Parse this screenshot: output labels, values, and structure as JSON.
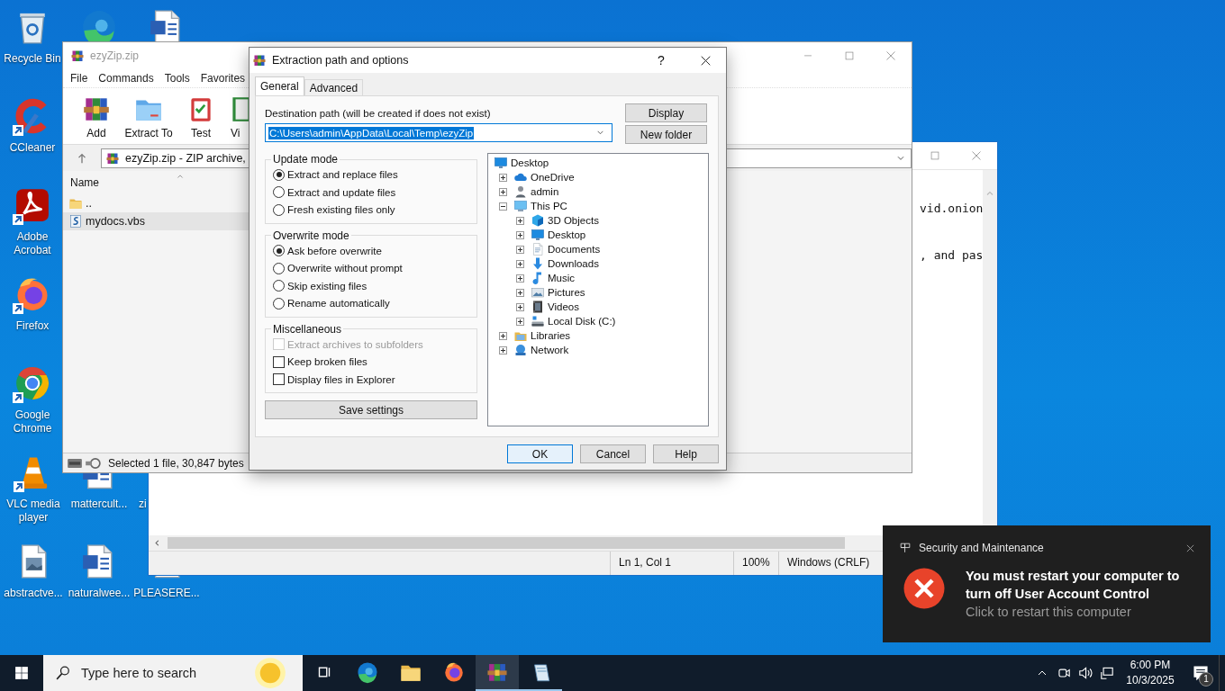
{
  "desktop_icons": [
    {
      "kind": "recycle-bin",
      "label": "Recycle Bin",
      "shortcut": false
    },
    {
      "kind": "edge",
      "shortcut": false
    },
    {
      "kind": "word",
      "shortcut": false
    },
    {
      "kind": "ccleaner",
      "label": "CCleaner",
      "shortcut": true
    },
    {
      "kind": "acrobat",
      "label": "Adobe Acrobat",
      "shortcut": true
    },
    {
      "kind": "firefox",
      "label": "Firefox",
      "shortcut": true
    },
    {
      "kind": "chrome",
      "label": "Google Chrome",
      "shortcut": true
    },
    {
      "kind": "vlc",
      "label": "VLC media player",
      "shortcut": true
    },
    {
      "kind": "word",
      "label": "mattercult...",
      "shortcut": false
    },
    {
      "kind": "none",
      "label": "zi"
    },
    {
      "kind": "image-doc",
      "label": "abstractve...",
      "shortcut": false
    },
    {
      "kind": "word",
      "label": "naturalwee...",
      "shortcut": false
    },
    {
      "kind": "text-doc",
      "label": "PLEASERE...",
      "shortcut": false
    }
  ],
  "notepad": {
    "text_lines": [
      "vid.onion",
      ", and pas"
    ],
    "status": {
      "position": "Ln 1, Col 1",
      "zoom": "100%",
      "line_ending": "Windows (CRLF)"
    }
  },
  "winrar": {
    "title": "ezyZip.zip",
    "menu": [
      "File",
      "Commands",
      "Tools",
      "Favorites"
    ],
    "toolbar": [
      {
        "kind": "winrar",
        "label": "Add"
      },
      {
        "kind": "folder-blue",
        "label": "Extract To"
      },
      {
        "kind": "test",
        "label": "Test"
      },
      {
        "kind": "view",
        "label": "Vi"
      }
    ],
    "address": "ezyZip.zip - ZIP archive,",
    "columns": [
      "Name"
    ],
    "files": [
      {
        "kind": "folder",
        "name": "..",
        "selected": false
      },
      {
        "kind": "script",
        "name": "mydocs.vbs",
        "selected": true
      }
    ],
    "status": "Selected 1 file, 30,847 bytes"
  },
  "dialog": {
    "title": "Extraction path and options",
    "help": "?",
    "tabs": [
      {
        "label": "General",
        "selected": true
      },
      {
        "label": "Advanced",
        "selected": false
      }
    ],
    "destination": {
      "label": "Destination path (will be created if does not exist)",
      "value": "C:\\Users\\admin\\AppData\\Local\\Temp\\ezyZip",
      "highlighted": true
    },
    "side_buttons": [
      "Display",
      "New folder"
    ],
    "groups": [
      {
        "title": "Update mode",
        "kind": "radio",
        "options": [
          {
            "label": "Extract and replace files",
            "selected": true
          },
          {
            "label": "Extract and update files",
            "selected": false
          },
          {
            "label": "Fresh existing files only",
            "selected": false
          }
        ]
      },
      {
        "title": "Overwrite mode",
        "kind": "radio",
        "options": [
          {
            "label": "Ask before overwrite",
            "selected": true
          },
          {
            "label": "Overwrite without prompt",
            "selected": false
          },
          {
            "label": "Skip existing files",
            "selected": false
          },
          {
            "label": "Rename automatically",
            "selected": false
          }
        ]
      },
      {
        "title": "Miscellaneous",
        "kind": "checkbox",
        "options": [
          {
            "label": "Extract archives to subfolders",
            "checked": false,
            "disabled": true
          },
          {
            "label": "Keep broken files",
            "checked": false,
            "disabled": false
          },
          {
            "label": "Display files in Explorer",
            "checked": false,
            "disabled": false
          }
        ]
      }
    ],
    "save_button": "Save settings",
    "tree": [
      {
        "kind": "desktop",
        "label": "Desktop",
        "children": [
          {
            "kind": "cloud",
            "label": "OneDrive",
            "expanded": false
          },
          {
            "kind": "user",
            "label": "admin",
            "expanded": false
          },
          {
            "kind": "pc",
            "label": "This PC",
            "expanded": true,
            "children": [
              {
                "kind": "cube",
                "label": "3D Objects",
                "expanded": false
              },
              {
                "kind": "desktop",
                "label": "Desktop",
                "expanded": false
              },
              {
                "kind": "docs",
                "label": "Documents",
                "expanded": false
              },
              {
                "kind": "download",
                "label": "Downloads",
                "expanded": false
              },
              {
                "kind": "music",
                "label": "Music",
                "expanded": false
              },
              {
                "kind": "pictures",
                "label": "Pictures",
                "expanded": false
              },
              {
                "kind": "videos",
                "label": "Videos",
                "expanded": false
              },
              {
                "kind": "disk",
                "label": "Local Disk (C:)",
                "expanded": false
              }
            ]
          },
          {
            "kind": "libraries",
            "label": "Libraries",
            "expanded": false
          },
          {
            "kind": "network",
            "label": "Network",
            "expanded": false
          }
        ]
      }
    ],
    "buttons": [
      {
        "label": "OK",
        "default": true
      },
      {
        "label": "Cancel",
        "default": false
      },
      {
        "label": "Help",
        "default": false
      }
    ]
  },
  "notification": {
    "app": "Security and Maintenance",
    "title": "You must restart your computer to turn off User Account Control",
    "body": "Click to restart this computer"
  },
  "taskbar": {
    "search_placeholder": "Type here to search",
    "apps": [
      {
        "kind": "task-view",
        "running": false,
        "active": false
      },
      {
        "kind": "edge",
        "running": false,
        "active": false
      },
      {
        "kind": "folder",
        "running": false,
        "active": false
      },
      {
        "kind": "firefox",
        "running": false,
        "active": false
      },
      {
        "kind": "winrar",
        "running": true,
        "active": true
      },
      {
        "kind": "notepad",
        "running": true,
        "active": false
      }
    ],
    "time": "6:00 PM",
    "date": "10/3/2025",
    "notification_count": "1"
  }
}
